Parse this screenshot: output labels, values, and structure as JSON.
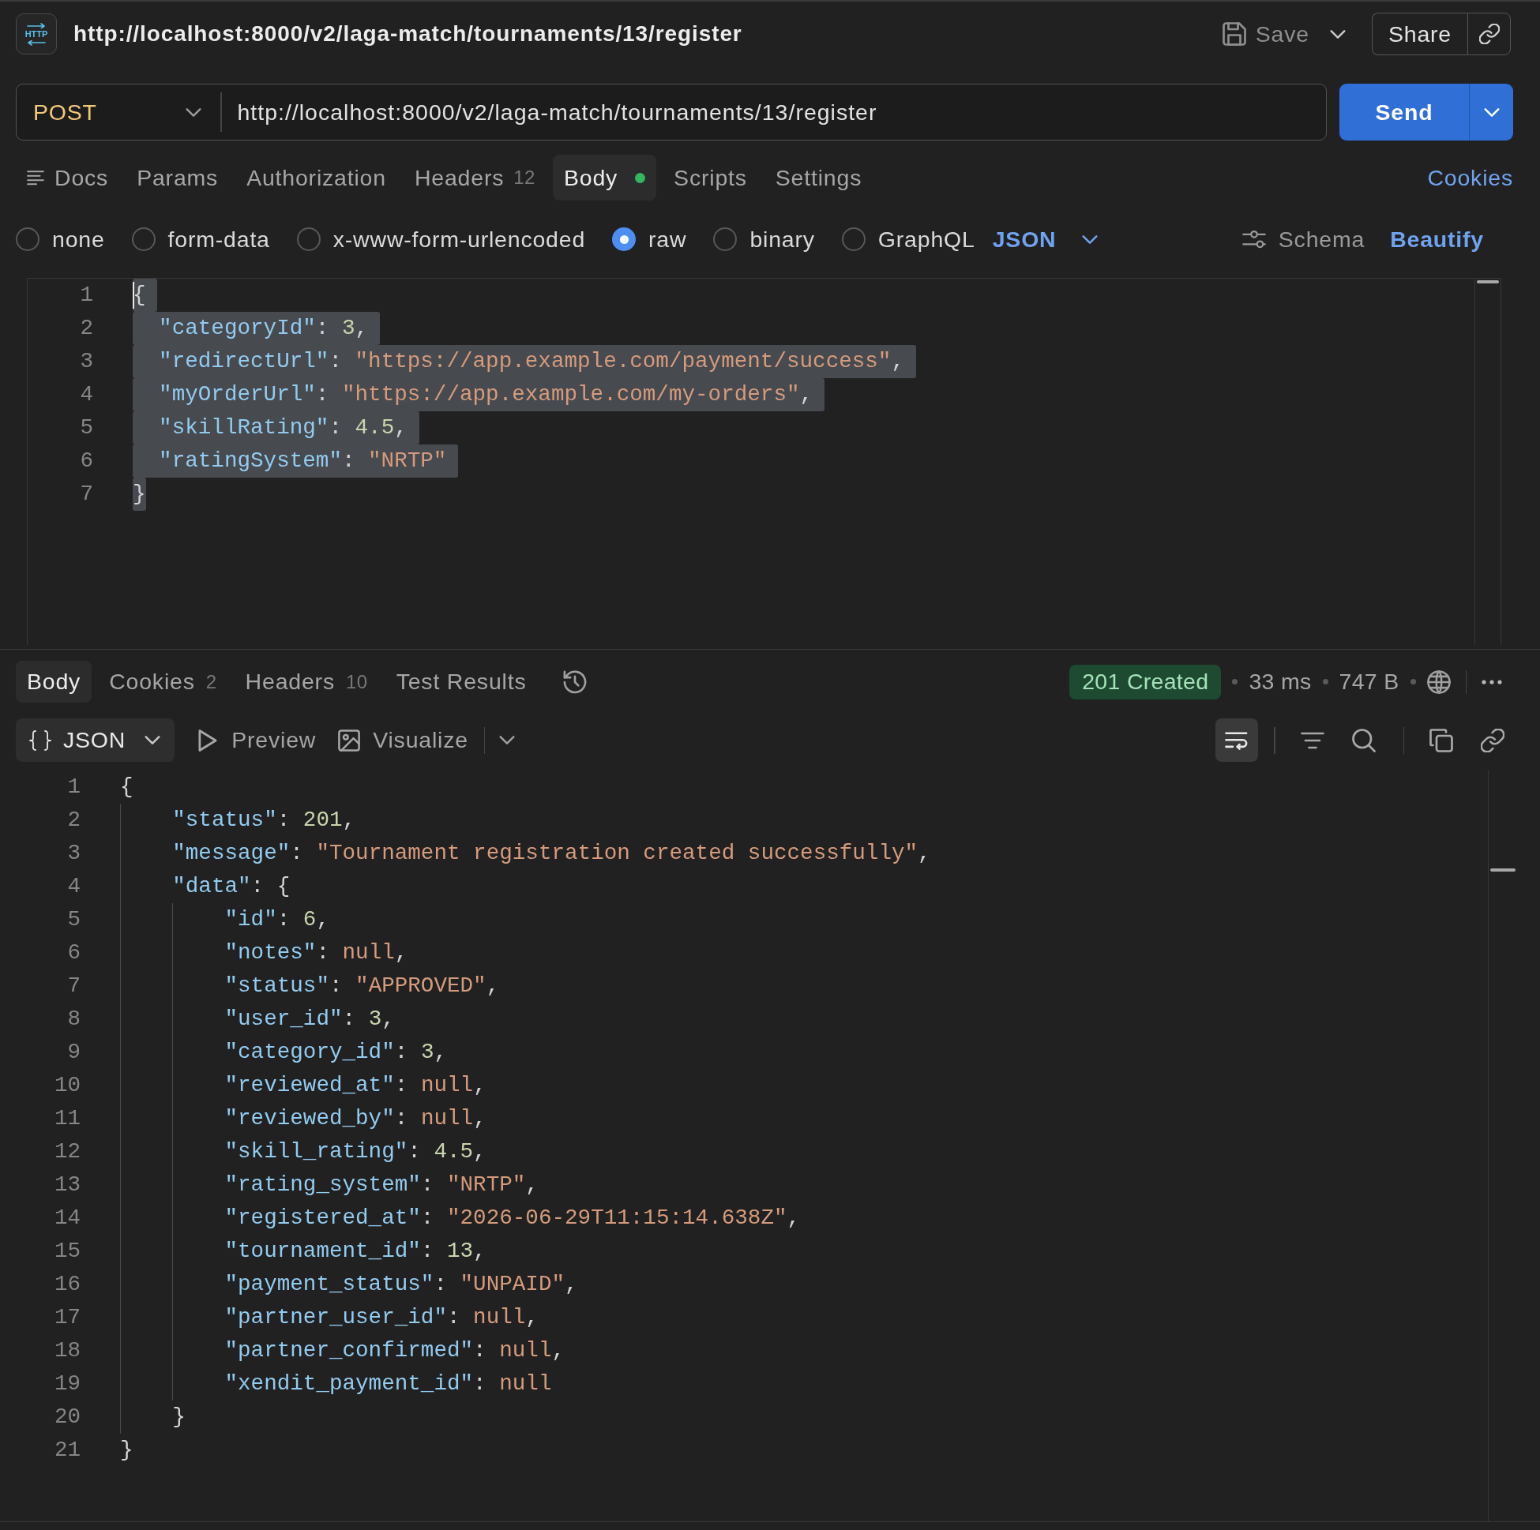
{
  "header": {
    "icon_label": "HTTP",
    "title": "http://localhost:8000/v2/laga-match/tournaments/13/register",
    "save": "Save",
    "share": "Share"
  },
  "url_bar": {
    "method": "POST",
    "url": "http://localhost:8000/v2/laga-match/tournaments/13/register",
    "send": "Send"
  },
  "request_tabs": {
    "docs": "Docs",
    "tabs": [
      {
        "label": "Params",
        "selected": false,
        "dot": false
      },
      {
        "label": "Authorization",
        "selected": false,
        "dot": false
      },
      {
        "label": "Headers",
        "count": "12",
        "selected": false,
        "dot": false
      },
      {
        "label": "Body",
        "selected": true,
        "dot": true
      },
      {
        "label": "Scripts",
        "selected": false,
        "dot": false
      },
      {
        "label": "Settings",
        "selected": false,
        "dot": false
      }
    ],
    "cookies": "Cookies"
  },
  "body_types": {
    "options": [
      {
        "label": "none",
        "selected": false
      },
      {
        "label": "form-data",
        "selected": false
      },
      {
        "label": "x-www-form-urlencoded",
        "selected": false
      },
      {
        "label": "raw",
        "selected": true
      },
      {
        "label": "binary",
        "selected": false
      },
      {
        "label": "GraphQL",
        "selected": false
      }
    ],
    "format": "JSON",
    "schema": "Schema",
    "beautify": "Beautify"
  },
  "request_body": {
    "number": "1",
    "selected": true,
    "caret": true,
    "tokens": [
      {
        "kind": "punct",
        "text": "{"
      }
    ],
    "children": [
      {
        "number": "2",
        "selected": true,
        "caret": false,
        "tokens": [
          {
            "kind": "key",
            "text": "\"categoryId\""
          },
          {
            "kind": "punct",
            "text": ": "
          },
          {
            "kind": "number",
            "text": "3"
          },
          {
            "kind": "punct",
            "text": ","
          }
        ]
      },
      {
        "number": "3",
        "selected": true,
        "caret": false,
        "tokens": [
          {
            "kind": "key",
            "text": "\"redirectUrl\""
          },
          {
            "kind": "punct",
            "text": ": "
          },
          {
            "kind": "string",
            "text": "\"https://app.example.com/payment/success\""
          },
          {
            "kind": "punct",
            "text": ","
          }
        ]
      },
      {
        "number": "4",
        "selected": true,
        "caret": false,
        "tokens": [
          {
            "kind": "key",
            "text": "\"myOrderUrl\""
          },
          {
            "kind": "punct",
            "text": ": "
          },
          {
            "kind": "string",
            "text": "\"https://app.example.com/my-orders\""
          },
          {
            "kind": "punct",
            "text": ","
          }
        ]
      },
      {
        "number": "5",
        "selected": true,
        "caret": false,
        "tokens": [
          {
            "kind": "key",
            "text": "\"skillRating\""
          },
          {
            "kind": "punct",
            "text": ": "
          },
          {
            "kind": "number",
            "text": "4.5"
          },
          {
            "kind": "punct",
            "text": ","
          }
        ]
      },
      {
        "number": "6",
        "selected": true,
        "caret": false,
        "tokens": [
          {
            "kind": "key",
            "text": "\"ratingSystem\""
          },
          {
            "kind": "punct",
            "text": ": "
          },
          {
            "kind": "string",
            "text": "\"NRTP\""
          }
        ]
      }
    ],
    "close": {
      "number": "7",
      "selected": true,
      "caret": false,
      "tokens": [
        {
          "kind": "punct",
          "text": "}"
        }
      ]
    }
  },
  "response_tabs": {
    "tabs": [
      {
        "label": "Body",
        "selected": true
      },
      {
        "label": "Cookies",
        "count": "2",
        "selected": false
      },
      {
        "label": "Headers",
        "count": "10",
        "selected": false
      },
      {
        "label": "Test Results",
        "selected": false
      }
    ],
    "status": "201 Created",
    "time": "33 ms",
    "size": "747 B"
  },
  "response_toolbar": {
    "format": "JSON",
    "preview": "Preview",
    "visualize": "Visualize",
    "wrap_on": true
  },
  "response_body": {
    "number": "1",
    "tokens": [
      {
        "kind": "punct",
        "text": "{"
      }
    ],
    "children": [
      {
        "number": "2",
        "tokens": [
          {
            "kind": "key",
            "text": "\"status\""
          },
          {
            "kind": "punct",
            "text": ": "
          },
          {
            "kind": "number",
            "text": "201"
          },
          {
            "kind": "punct",
            "text": ","
          }
        ]
      },
      {
        "number": "3",
        "tokens": [
          {
            "kind": "key",
            "text": "\"message\""
          },
          {
            "kind": "punct",
            "text": ": "
          },
          {
            "kind": "string",
            "text": "\"Tournament registration created successfully\""
          },
          {
            "kind": "punct",
            "text": ","
          }
        ]
      },
      {
        "number": "4",
        "tokens": [
          {
            "kind": "key",
            "text": "\"data\""
          },
          {
            "kind": "punct",
            "text": ": {"
          }
        ],
        "children": [
          {
            "number": "5",
            "tokens": [
              {
                "kind": "key",
                "text": "\"id\""
              },
              {
                "kind": "punct",
                "text": ": "
              },
              {
                "kind": "number",
                "text": "6"
              },
              {
                "kind": "punct",
                "text": ","
              }
            ]
          },
          {
            "number": "6",
            "tokens": [
              {
                "kind": "key",
                "text": "\"notes\""
              },
              {
                "kind": "punct",
                "text": ": "
              },
              {
                "kind": "null",
                "text": "null"
              },
              {
                "kind": "punct",
                "text": ","
              }
            ]
          },
          {
            "number": "7",
            "tokens": [
              {
                "kind": "key",
                "text": "\"status\""
              },
              {
                "kind": "punct",
                "text": ": "
              },
              {
                "kind": "string",
                "text": "\"APPROVED\""
              },
              {
                "kind": "punct",
                "text": ","
              }
            ]
          },
          {
            "number": "8",
            "tokens": [
              {
                "kind": "key",
                "text": "\"user_id\""
              },
              {
                "kind": "punct",
                "text": ": "
              },
              {
                "kind": "number",
                "text": "3"
              },
              {
                "kind": "punct",
                "text": ","
              }
            ]
          },
          {
            "number": "9",
            "tokens": [
              {
                "kind": "key",
                "text": "\"category_id\""
              },
              {
                "kind": "punct",
                "text": ": "
              },
              {
                "kind": "number",
                "text": "3"
              },
              {
                "kind": "punct",
                "text": ","
              }
            ]
          },
          {
            "number": "10",
            "tokens": [
              {
                "kind": "key",
                "text": "\"reviewed_at\""
              },
              {
                "kind": "punct",
                "text": ": "
              },
              {
                "kind": "null",
                "text": "null"
              },
              {
                "kind": "punct",
                "text": ","
              }
            ]
          },
          {
            "number": "11",
            "tokens": [
              {
                "kind": "key",
                "text": "\"reviewed_by\""
              },
              {
                "kind": "punct",
                "text": ": "
              },
              {
                "kind": "null",
                "text": "null"
              },
              {
                "kind": "punct",
                "text": ","
              }
            ]
          },
          {
            "number": "12",
            "tokens": [
              {
                "kind": "key",
                "text": "\"skill_rating\""
              },
              {
                "kind": "punct",
                "text": ": "
              },
              {
                "kind": "number",
                "text": "4.5"
              },
              {
                "kind": "punct",
                "text": ","
              }
            ]
          },
          {
            "number": "13",
            "tokens": [
              {
                "kind": "key",
                "text": "\"rating_system\""
              },
              {
                "kind": "punct",
                "text": ": "
              },
              {
                "kind": "string",
                "text": "\"NRTP\""
              },
              {
                "kind": "punct",
                "text": ","
              }
            ]
          },
          {
            "number": "14",
            "tokens": [
              {
                "kind": "key",
                "text": "\"registered_at\""
              },
              {
                "kind": "punct",
                "text": ": "
              },
              {
                "kind": "string",
                "text": "\"2026-06-29T11:15:14.638Z\""
              },
              {
                "kind": "punct",
                "text": ","
              }
            ]
          },
          {
            "number": "15",
            "tokens": [
              {
                "kind": "key",
                "text": "\"tournament_id\""
              },
              {
                "kind": "punct",
                "text": ": "
              },
              {
                "kind": "number",
                "text": "13"
              },
              {
                "kind": "punct",
                "text": ","
              }
            ]
          },
          {
            "number": "16",
            "tokens": [
              {
                "kind": "key",
                "text": "\"payment_status\""
              },
              {
                "kind": "punct",
                "text": ": "
              },
              {
                "kind": "string",
                "text": "\"UNPAID\""
              },
              {
                "kind": "punct",
                "text": ","
              }
            ]
          },
          {
            "number": "17",
            "tokens": [
              {
                "kind": "key",
                "text": "\"partner_user_id\""
              },
              {
                "kind": "punct",
                "text": ": "
              },
              {
                "kind": "null",
                "text": "null"
              },
              {
                "kind": "punct",
                "text": ","
              }
            ]
          },
          {
            "number": "18",
            "tokens": [
              {
                "kind": "key",
                "text": "\"partner_confirmed\""
              },
              {
                "kind": "punct",
                "text": ": "
              },
              {
                "kind": "null",
                "text": "null"
              },
              {
                "kind": "punct",
                "text": ","
              }
            ]
          },
          {
            "number": "19",
            "tokens": [
              {
                "kind": "key",
                "text": "\"xendit_payment_id\""
              },
              {
                "kind": "punct",
                "text": ": "
              },
              {
                "kind": "null",
                "text": "null"
              }
            ]
          }
        ],
        "close": {
          "number": "20",
          "tokens": [
            {
              "kind": "punct",
              "text": "}"
            }
          ]
        }
      }
    ],
    "close": {
      "number": "21",
      "tokens": [
        {
          "kind": "punct",
          "text": "}"
        }
      ]
    }
  }
}
